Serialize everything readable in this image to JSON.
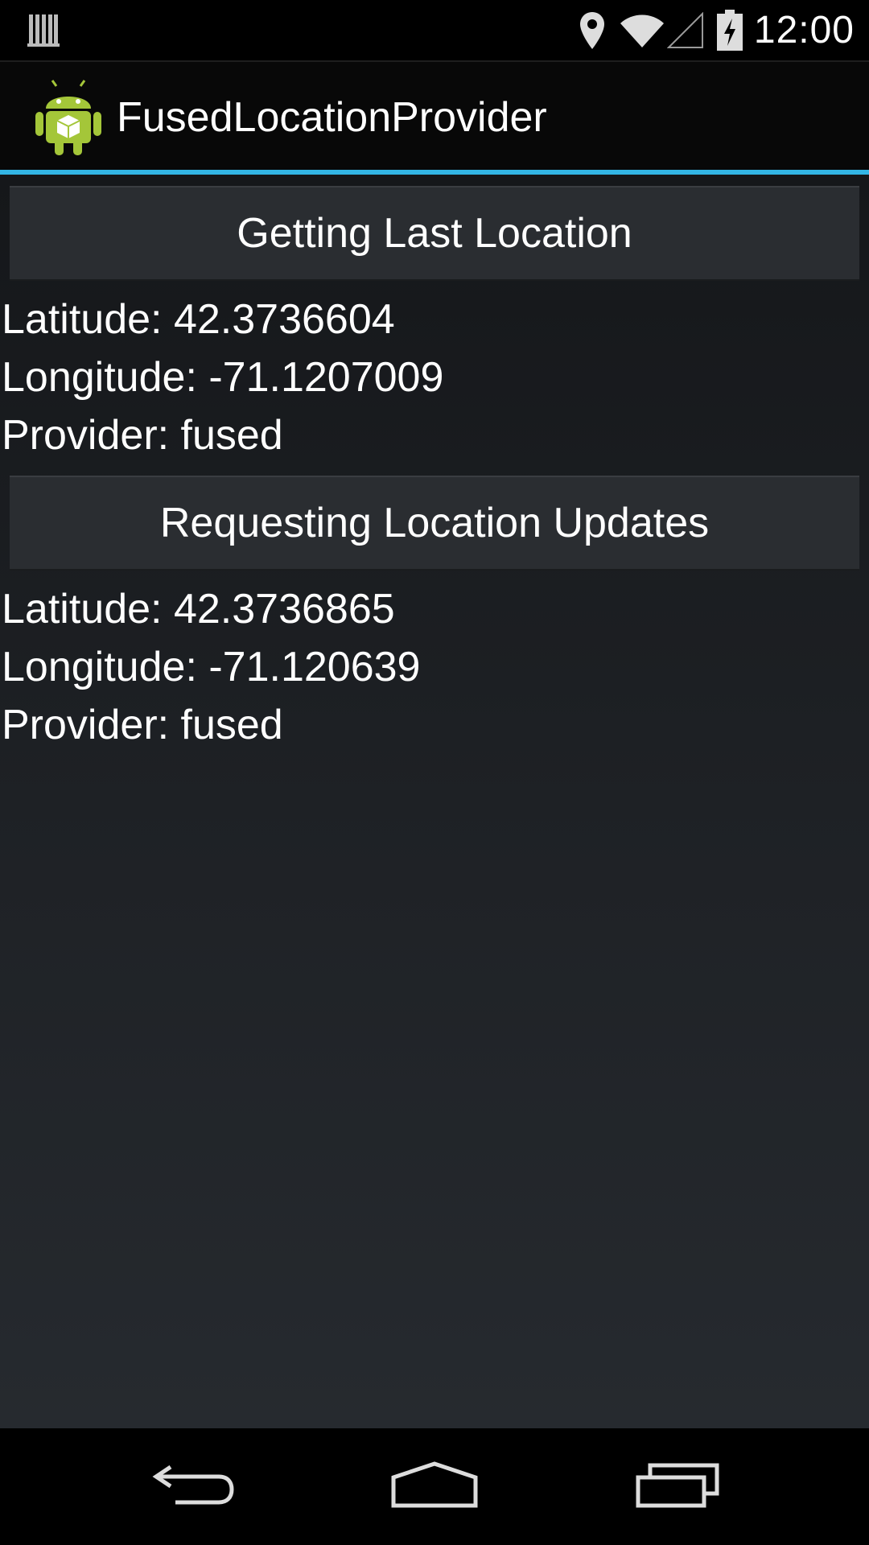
{
  "status_bar": {
    "time": "12:00",
    "icons": [
      "notification-icon",
      "location-pin-icon",
      "wifi-icon",
      "signal-icon",
      "battery-charging-icon"
    ]
  },
  "action_bar": {
    "app_icon": "android-robot-icon",
    "title": "FusedLocationProvider",
    "accent_color": "#33b5e5"
  },
  "main": {
    "last_location": {
      "button_label": "Getting Last Location",
      "latitude": "Latitude: 42.3736604",
      "longitude": "Longitude: -71.1207009",
      "provider": "Provider: fused"
    },
    "updates": {
      "button_label": "Requesting Location Updates",
      "latitude": "Latitude: 42.3736865",
      "longitude": "Longitude: -71.120639",
      "provider": "Provider: fused"
    }
  },
  "nav_bar": {
    "buttons": [
      "back-icon",
      "home-icon",
      "recents-icon"
    ]
  }
}
